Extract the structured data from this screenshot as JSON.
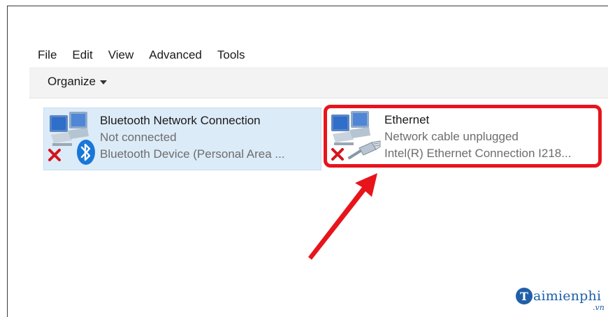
{
  "menu": {
    "file": "File",
    "edit": "Edit",
    "view": "View",
    "advanced": "Advanced",
    "tools": "Tools"
  },
  "toolbar": {
    "organize_label": "Organize"
  },
  "connections": [
    {
      "name": "Bluetooth Network Connection",
      "status": "Not connected",
      "device": "Bluetooth Device (Personal Area ...",
      "icon": "bluetooth-network-icon",
      "selected": true
    },
    {
      "name": "Ethernet",
      "status": "Network cable unplugged",
      "device": "Intel(R) Ethernet Connection I218...",
      "icon": "ethernet-network-icon",
      "selected": false
    }
  ],
  "annotation": {
    "highlight_color": "#e8141c"
  },
  "watermark": {
    "letter": "T",
    "text": "aimienphi",
    "suffix": ".vn"
  }
}
